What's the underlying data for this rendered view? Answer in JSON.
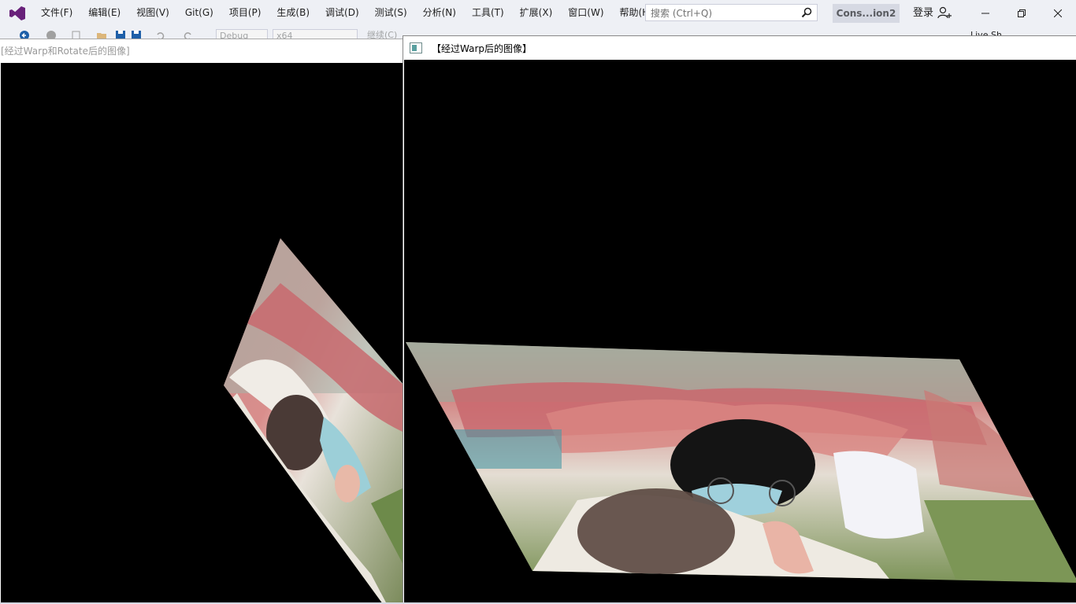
{
  "app": {
    "menu": [
      {
        "label": "文件(F)"
      },
      {
        "label": "编辑(E)"
      },
      {
        "label": "视图(V)"
      },
      {
        "label": "Git(G)"
      },
      {
        "label": "项目(P)"
      },
      {
        "label": "生成(B)"
      },
      {
        "label": "调试(D)"
      },
      {
        "label": "测试(S)"
      },
      {
        "label": "分析(N)"
      },
      {
        "label": "工具(T)"
      },
      {
        "label": "扩展(X)"
      },
      {
        "label": "窗口(W)"
      },
      {
        "label": "帮助(H)"
      }
    ],
    "search_placeholder": "搜索 (Ctrl+Q)",
    "solution_name": "Cons...ion2",
    "sign_in": "登录",
    "accent_color": "#68217a"
  },
  "toolbar": {
    "configuration": "Debug",
    "platform": "x64",
    "continue_label": "继续(C)",
    "live_share": "Live Sh..."
  },
  "windows": {
    "rotate": {
      "title": "[经过Warp和Rotate后的图像]"
    },
    "warp": {
      "title": "【经过Warp后的图像】"
    }
  }
}
